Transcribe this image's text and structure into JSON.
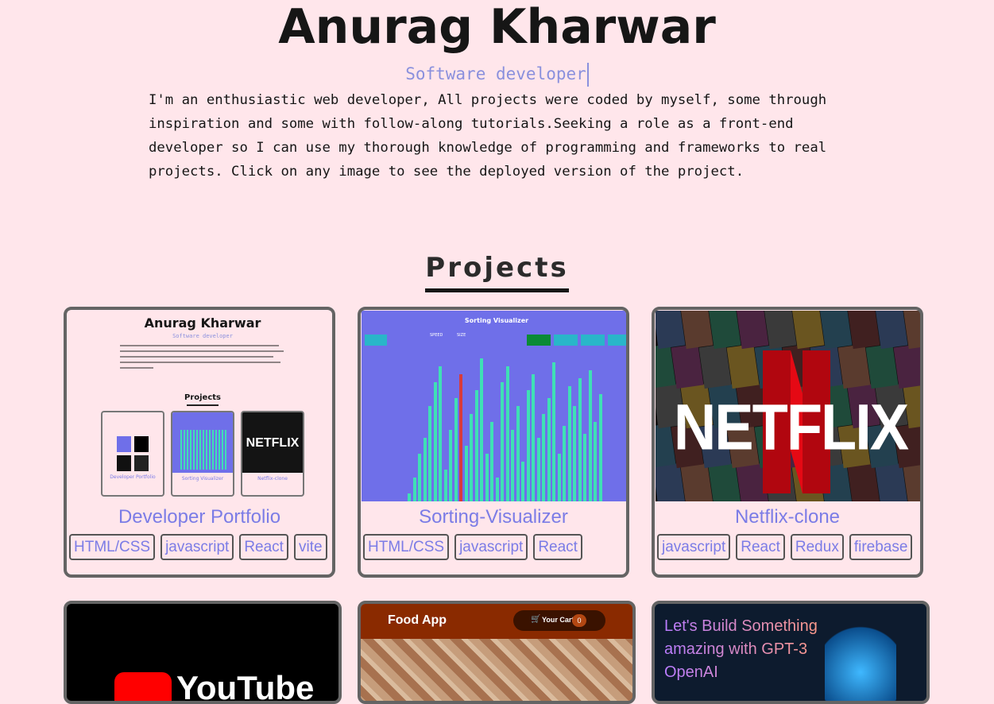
{
  "header": {
    "name": "Anurag Kharwar",
    "role": "Software developer",
    "intro": "I'm an enthusiastic web developer, All projects were coded by myself, some through inspiration and some with follow-along tutorials.Seeking a role as a front-end developer so I can use my thorough knowledge of programming and frameworks to real projects. Click on any image to see the deployed version of the project."
  },
  "projects_title": "Projects",
  "projects": [
    {
      "title": "Developer Portfolio",
      "tags": [
        "HTML/CSS",
        "javascript",
        "React",
        "vite"
      ],
      "thumb": {
        "name": "Anurag Kharwar",
        "role": "Software developer",
        "section": "Projects",
        "cards": [
          "Developer Portfolio",
          "Sorting Visualizer",
          "Netflix-clone"
        ]
      }
    },
    {
      "title": "Sorting-Visualizer",
      "tags": [
        "HTML/CSS",
        "javascript",
        "React"
      ],
      "thumb": {
        "title": "Sorting Visualizer",
        "speed": "SPEED",
        "size": "SIZE"
      }
    },
    {
      "title": "Netflix-clone",
      "tags": [
        "javascript",
        "React",
        "Redux",
        "firebase"
      ],
      "thumb": {
        "word": "NETFLIX"
      }
    }
  ],
  "bottom_cards": {
    "youtube": {
      "word": "YouTube"
    },
    "food": {
      "title": "Food App",
      "cart_label": "Your Cart",
      "cart_count": "0"
    },
    "gpt": {
      "line1": "Let's Build Something",
      "line2": "amazing with GPT-3",
      "line3": "OpenAI"
    }
  },
  "colors": {
    "background": "#ffe6eb",
    "accent": "#7b7ce6",
    "role": "#8a90dd",
    "card_border": "#646464"
  }
}
